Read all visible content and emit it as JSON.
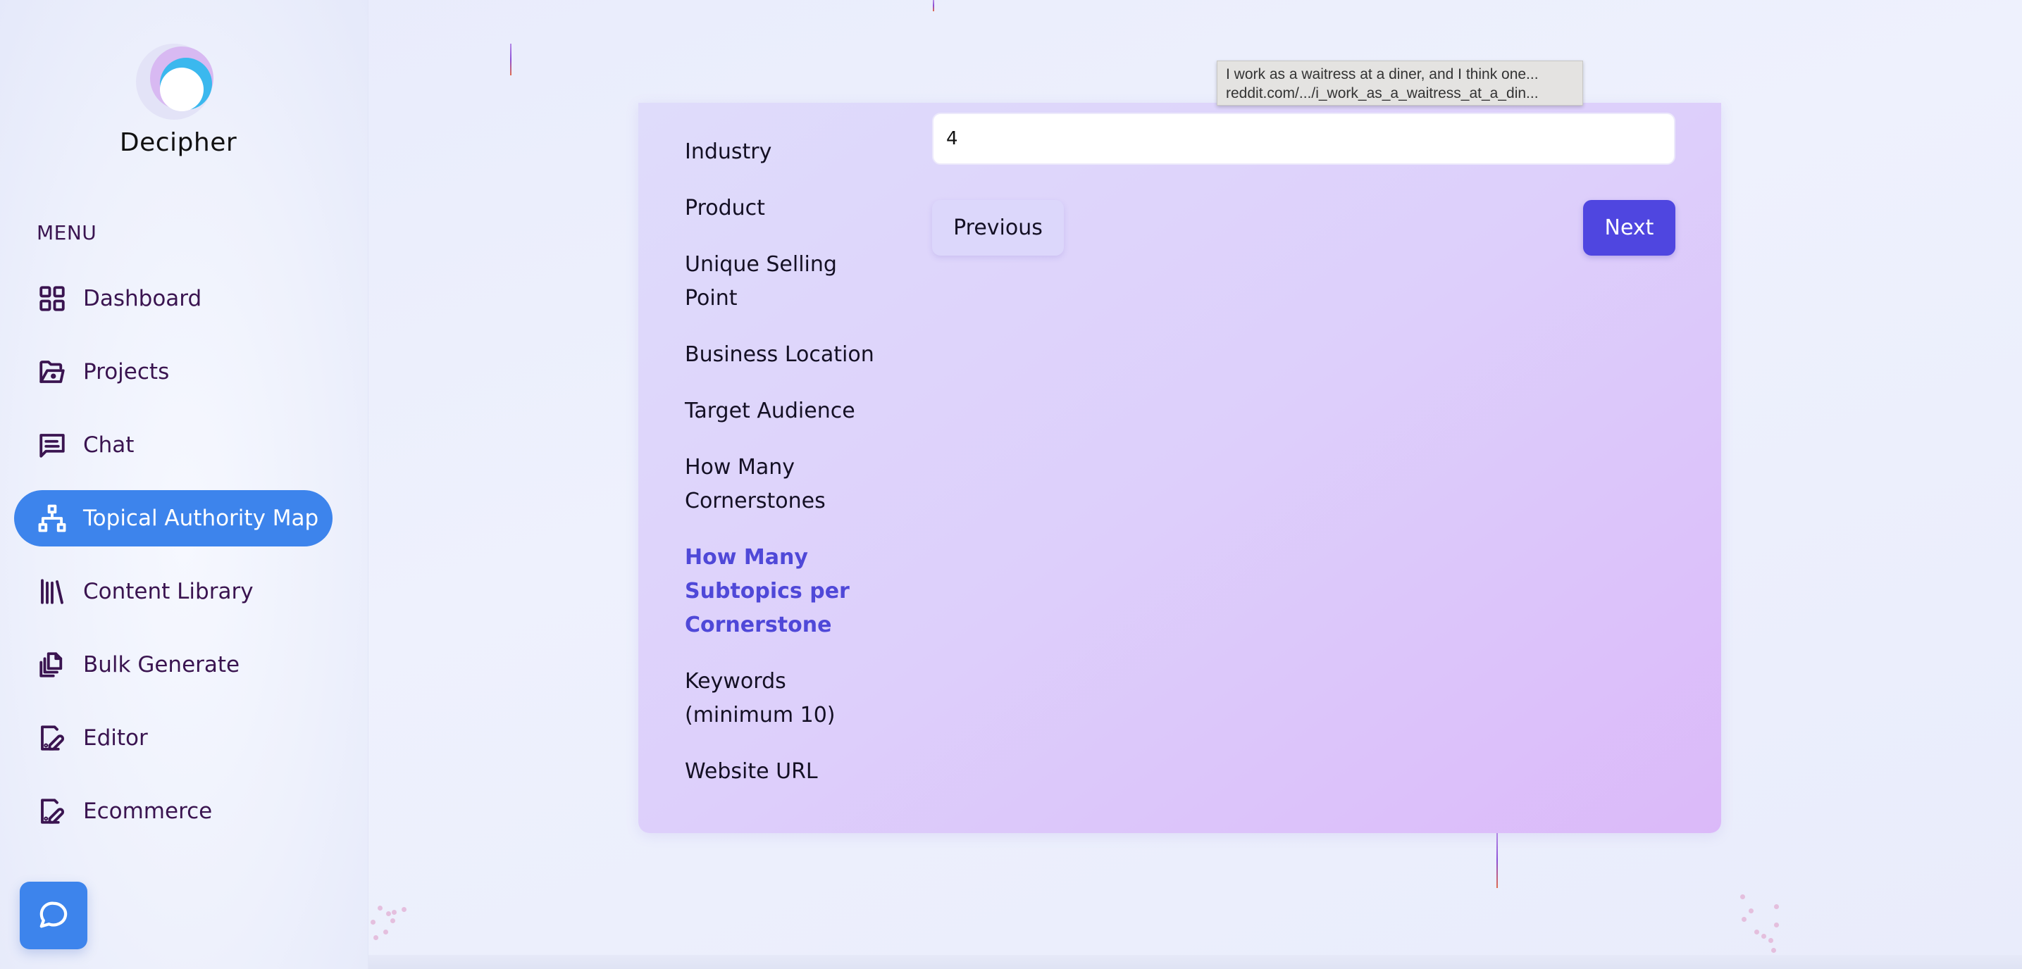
{
  "brand": {
    "name": "Decipher",
    "logo_icon": "decipher-logo"
  },
  "sidebar": {
    "menu_label": "MENU",
    "items": [
      {
        "label": "Dashboard",
        "icon": "grid-icon",
        "active": false
      },
      {
        "label": "Projects",
        "icon": "folder-icon",
        "active": false
      },
      {
        "label": "Chat",
        "icon": "message-icon",
        "active": false
      },
      {
        "label": "Topical Authority Map",
        "icon": "sitemap-icon",
        "active": true
      },
      {
        "label": "Content Library",
        "icon": "library-icon",
        "active": false
      },
      {
        "label": "Bulk Generate",
        "icon": "copy-files-icon",
        "active": false
      },
      {
        "label": "Editor",
        "icon": "edit-file-icon",
        "active": false
      },
      {
        "label": "Ecommerce",
        "icon": "edit-file-icon",
        "active": false
      }
    ],
    "chat_button_icon": "chat-bubble-icon"
  },
  "wizard": {
    "steps": [
      {
        "label": "Industry",
        "active": false
      },
      {
        "label": "Product",
        "active": false
      },
      {
        "label": "Unique Selling Point",
        "active": false
      },
      {
        "label": "Business Location",
        "active": false
      },
      {
        "label": "Target Audience",
        "active": false
      },
      {
        "label": "How Many Cornerstones",
        "active": false
      },
      {
        "label": "How Many Subtopics per Cornerstone",
        "active": true
      },
      {
        "label": "Keywords (minimum 10)",
        "active": false
      },
      {
        "label": "Website URL",
        "active": false
      }
    ],
    "input_value": "4",
    "previous_label": "Previous",
    "next_label": "Next",
    "accent_color": "#4f46e0"
  },
  "tooltip": {
    "line1": "I work as a waitress at a diner, and I think one...",
    "line2": "reddit.com/.../i_work_as_a_waitress_at_a_din..."
  }
}
